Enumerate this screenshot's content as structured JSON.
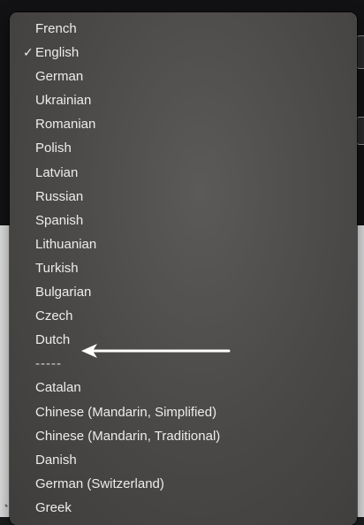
{
  "menu": {
    "checkmark": "✓",
    "items": [
      {
        "label": "French"
      },
      {
        "label": "English"
      },
      {
        "label": "German"
      },
      {
        "label": "Ukrainian"
      },
      {
        "label": "Romanian"
      },
      {
        "label": "Polish"
      },
      {
        "label": "Latvian"
      },
      {
        "label": "Russian"
      },
      {
        "label": "Spanish"
      },
      {
        "label": "Lithuanian"
      },
      {
        "label": "Turkish"
      },
      {
        "label": "Bulgarian"
      },
      {
        "label": "Czech"
      },
      {
        "label": "Dutch"
      },
      {
        "label": "-----"
      },
      {
        "label": "Catalan"
      },
      {
        "label": "Chinese (Mandarin, Simplified)"
      },
      {
        "label": "Chinese (Mandarin, Traditional)"
      },
      {
        "label": "Danish"
      },
      {
        "label": "German (Switzerland)"
      },
      {
        "label": "Greek"
      }
    ]
  },
  "annotation": {
    "arrow_color": "#ffffff"
  }
}
